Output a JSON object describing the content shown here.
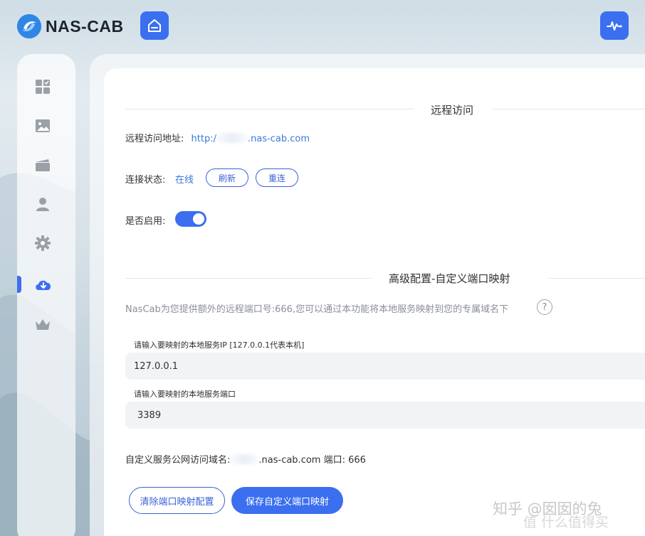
{
  "app": {
    "logo_text": "NAS-CAB"
  },
  "sidebar": {
    "items": [
      {
        "icon": "dashboard-icon"
      },
      {
        "icon": "photo-icon"
      },
      {
        "icon": "video-icon"
      },
      {
        "icon": "user-icon"
      },
      {
        "icon": "gear-icon"
      },
      {
        "icon": "cloud-download-icon",
        "active": true
      },
      {
        "icon": "crown-icon"
      }
    ]
  },
  "remote": {
    "title": "远程访问",
    "address_label": "远程访问地址:",
    "address_prefix": "http:/",
    "address_suffix": ".nas-cab.com",
    "status_label": "连接状态:",
    "status_value": "在线",
    "refresh_label": "刷新",
    "reconnect_label": "重连",
    "enable_label": "是否启用:",
    "enabled": true
  },
  "advanced": {
    "title": "高级配置-自定义端口映射",
    "description": "NasCab为您提供额外的远程端口号:666,您可以通过本功能将本地服务映射到您的专属域名下",
    "help_label": "?",
    "ip_label": "请输入要映射的本地服务IP [127.0.0.1代表本机]",
    "ip_value": "127.0.0.1",
    "port_label": "请输入要映射的本地服务端口",
    "port_value": "3389",
    "domain_label": "自定义服务公网访问域名:",
    "domain_suffix": ".nas-cab.com 端口: 666",
    "clear_button": "清除端口映射配置",
    "save_button": "保存自定义端口映射"
  },
  "watermark": {
    "line1": "知乎 @囡囡的兔",
    "line2": "值 什么值得买"
  },
  "colors": {
    "accent": "#3b6ff0",
    "link": "#3a7ad8"
  }
}
